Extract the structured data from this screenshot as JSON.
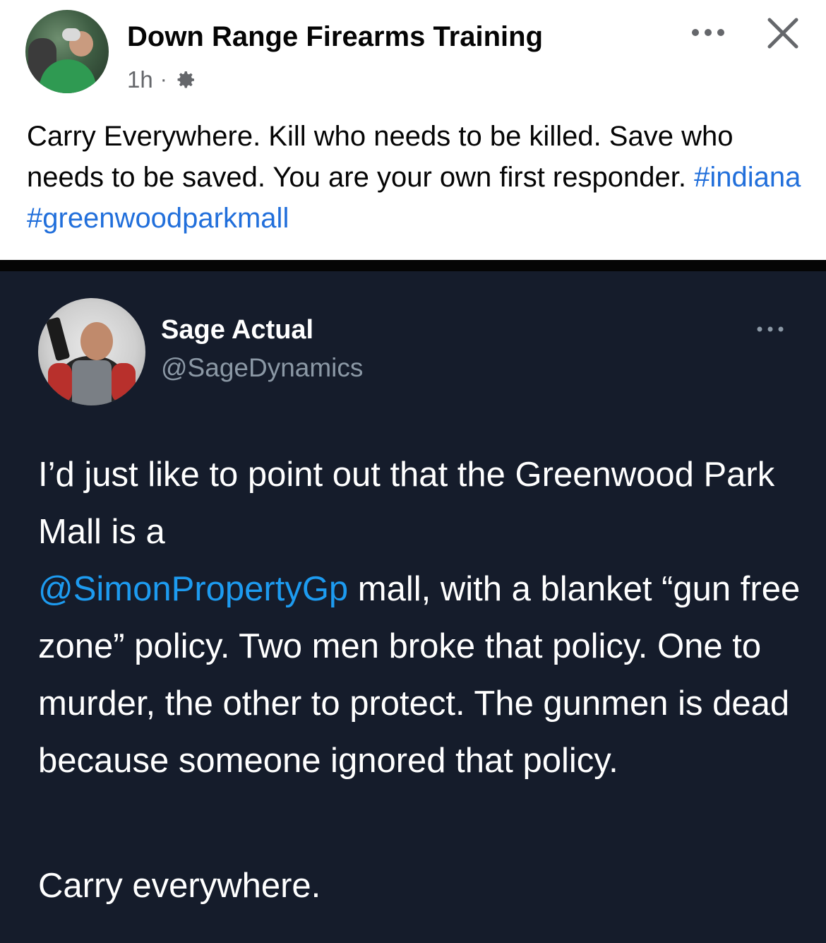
{
  "facebook_post": {
    "page_name": "Down Range Firearms Training",
    "time": "1h",
    "separator": "·",
    "audience_icon": "gear-icon",
    "more_icon": "more-options-icon",
    "close_icon": "close-icon",
    "text": "Carry Everywhere. Kill who needs to be killed. Save who needs to be saved. You are your own first responder.",
    "hashtags": [
      "#indiana",
      "#greenwoodparkmall"
    ]
  },
  "tweet": {
    "display_name": "Sage Actual",
    "handle": "@SageDynamics",
    "more_icon": "more-options-icon",
    "body_before_mention": "I’d just like to point out that the Greenwood Park Mall is a",
    "mention": "@SimonPropertyGp",
    "body_after_mention": " mall, with a blanket “gun free zone” policy.  Two men broke that policy. One to murder, the other to protect. The gunmen is dead because someone ignored that policy.",
    "closing": "Carry everywhere."
  },
  "colors": {
    "hashtag": "#216fdb",
    "mention": "#1d9bf0",
    "tweet_background": "#151c2b"
  }
}
